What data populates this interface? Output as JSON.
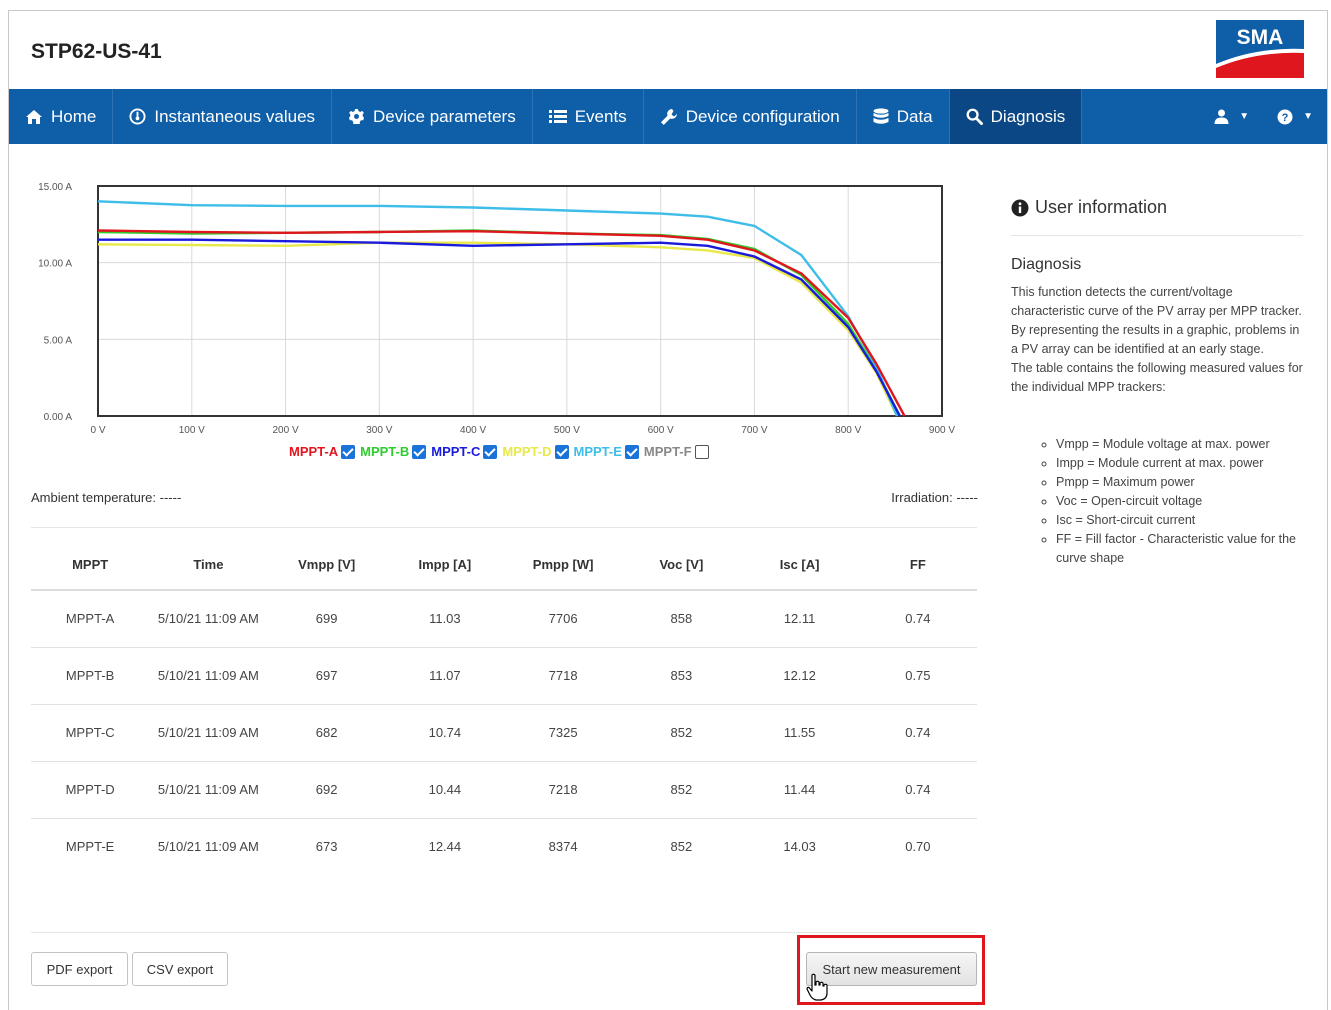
{
  "header": {
    "device_name": "STP62-US-41",
    "logo_text": "SMA",
    "brand_colors": {
      "blue": "#0e5ea8",
      "red": "#e0161e"
    }
  },
  "nav": {
    "items": [
      {
        "label": "Home",
        "icon": "home-icon"
      },
      {
        "label": "Instantaneous values",
        "icon": "gauge-icon"
      },
      {
        "label": "Device parameters",
        "icon": "gear-icon"
      },
      {
        "label": "Events",
        "icon": "list-icon"
      },
      {
        "label": "Device configuration",
        "icon": "wrench-icon"
      },
      {
        "label": "Data",
        "icon": "database-icon"
      },
      {
        "label": "Diagnosis",
        "icon": "search-icon",
        "active": true
      }
    ],
    "right": [
      {
        "icon": "user-icon"
      },
      {
        "icon": "help-icon"
      }
    ]
  },
  "chart_data": {
    "type": "line",
    "xlabel": "",
    "ylabel": "",
    "x_ticks": [
      "0 V",
      "100 V",
      "200 V",
      "300 V",
      "400 V",
      "500 V",
      "600 V",
      "700 V",
      "800 V",
      "900 V"
    ],
    "y_ticks": [
      "0.00 A",
      "5.00 A",
      "10.00 A",
      "15.00 A"
    ],
    "xlim": [
      0,
      900
    ],
    "ylim": [
      0,
      15
    ],
    "grid": true,
    "series": [
      {
        "name": "MPPT-A",
        "color": "#e0161e",
        "checked": true,
        "points": [
          [
            0,
            12.1
          ],
          [
            100,
            12.0
          ],
          [
            200,
            11.95
          ],
          [
            300,
            12.0
          ],
          [
            400,
            12.05
          ],
          [
            500,
            11.9
          ],
          [
            600,
            11.75
          ],
          [
            650,
            11.5
          ],
          [
            700,
            10.8
          ],
          [
            750,
            9.3
          ],
          [
            800,
            6.4
          ],
          [
            830,
            3.4
          ],
          [
            860,
            0
          ]
        ]
      },
      {
        "name": "MPPT-B",
        "color": "#2ecc2e",
        "checked": true,
        "points": [
          [
            0,
            12.0
          ],
          [
            100,
            11.9
          ],
          [
            200,
            11.95
          ],
          [
            300,
            12.0
          ],
          [
            400,
            12.1
          ],
          [
            500,
            11.9
          ],
          [
            600,
            11.8
          ],
          [
            650,
            11.55
          ],
          [
            700,
            10.9
          ],
          [
            750,
            9.2
          ],
          [
            800,
            6.0
          ],
          [
            830,
            3.0
          ],
          [
            855,
            0
          ]
        ]
      },
      {
        "name": "MPPT-C",
        "color": "#1a1adc",
        "checked": true,
        "points": [
          [
            0,
            11.5
          ],
          [
            100,
            11.5
          ],
          [
            200,
            11.4
          ],
          [
            300,
            11.3
          ],
          [
            400,
            11.1
          ],
          [
            500,
            11.2
          ],
          [
            600,
            11.3
          ],
          [
            650,
            11.1
          ],
          [
            700,
            10.4
          ],
          [
            750,
            8.9
          ],
          [
            800,
            5.8
          ],
          [
            830,
            2.9
          ],
          [
            855,
            0
          ]
        ]
      },
      {
        "name": "MPPT-D",
        "color": "#e8e84a",
        "checked": true,
        "points": [
          [
            0,
            11.2
          ],
          [
            100,
            11.15
          ],
          [
            200,
            11.1
          ],
          [
            300,
            11.3
          ],
          [
            400,
            11.3
          ],
          [
            500,
            11.2
          ],
          [
            600,
            11.0
          ],
          [
            650,
            10.8
          ],
          [
            700,
            10.3
          ],
          [
            750,
            8.7
          ],
          [
            800,
            5.6
          ],
          [
            830,
            2.8
          ],
          [
            852,
            0
          ]
        ]
      },
      {
        "name": "MPPT-E",
        "color": "#3dbde8",
        "checked": true,
        "points": [
          [
            0,
            14.0
          ],
          [
            100,
            13.75
          ],
          [
            200,
            13.7
          ],
          [
            300,
            13.7
          ],
          [
            400,
            13.6
          ],
          [
            500,
            13.4
          ],
          [
            600,
            13.2
          ],
          [
            650,
            13.0
          ],
          [
            700,
            12.4
          ],
          [
            750,
            10.5
          ],
          [
            800,
            6.5
          ],
          [
            830,
            3.2
          ],
          [
            852,
            0
          ]
        ]
      },
      {
        "name": "MPPT-F",
        "color": "#888888",
        "checked": false,
        "points": []
      }
    ]
  },
  "conditions": {
    "ambient_label": "Ambient temperature:",
    "ambient_value": "-----",
    "irradiation_label": "Irradiation:",
    "irradiation_value": "-----"
  },
  "table": {
    "columns": [
      "MPPT",
      "Time",
      "Vmpp [V]",
      "Impp [A]",
      "Pmpp [W]",
      "Voc [V]",
      "Isc [A]",
      "FF"
    ],
    "rows": [
      [
        "MPPT-A",
        "5/10/21 11:09 AM",
        "699",
        "11.03",
        "7706",
        "858",
        "12.11",
        "0.74"
      ],
      [
        "MPPT-B",
        "5/10/21 11:09 AM",
        "697",
        "11.07",
        "7718",
        "853",
        "12.12",
        "0.75"
      ],
      [
        "MPPT-C",
        "5/10/21 11:09 AM",
        "682",
        "10.74",
        "7325",
        "852",
        "11.55",
        "0.74"
      ],
      [
        "MPPT-D",
        "5/10/21 11:09 AM",
        "692",
        "10.44",
        "7218",
        "852",
        "11.44",
        "0.74"
      ],
      [
        "MPPT-E",
        "5/10/21 11:09 AM",
        "673",
        "12.44",
        "8374",
        "852",
        "14.03",
        "0.70"
      ]
    ]
  },
  "buttons": {
    "pdf_export": "PDF export",
    "csv_export": "CSV export",
    "start_measurement": "Start new measurement"
  },
  "sidebar": {
    "heading": "User information",
    "title": "Diagnosis",
    "paragraph1": "This function detects the current/voltage characteristic curve of the PV array per MPP tracker. By representing the results in a graphic, problems in a PV array can be identified at an early stage.",
    "paragraph2": "The table contains the following measured values for the individual MPP trackers:",
    "list": [
      "Vmpp = Module voltage at max. power",
      "Impp = Module current at max. power",
      "Pmpp = Maximum power",
      "Voc = Open-circuit voltage",
      "Isc = Short-circuit current",
      "FF = Fill factor - Characteristic value for the curve shape"
    ]
  }
}
